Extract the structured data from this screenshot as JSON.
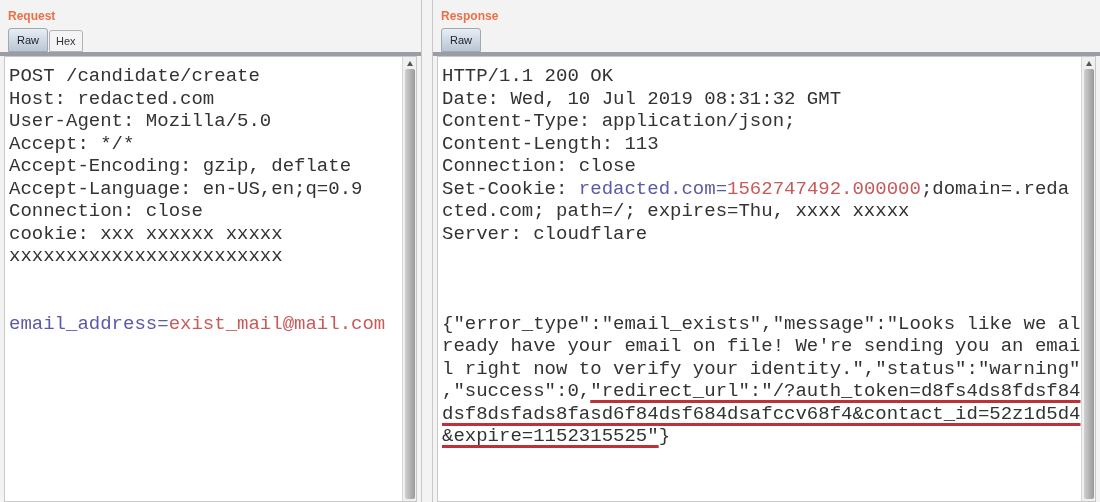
{
  "request": {
    "title": "Request",
    "tabs": [
      {
        "label": "Raw",
        "selected": true
      },
      {
        "label": "Hex",
        "selected": false
      }
    ],
    "lines": [
      {
        "kind": "text",
        "segments": [
          {
            "kind": "plain",
            "text": "POST /candidate/create"
          }
        ]
      },
      {
        "kind": "text",
        "segments": [
          {
            "kind": "plain",
            "text": "Host: redacted.com"
          }
        ]
      },
      {
        "kind": "text",
        "segments": [
          {
            "kind": "plain",
            "text": "User-Agent: Mozilla/5.0"
          }
        ]
      },
      {
        "kind": "text",
        "segments": [
          {
            "kind": "plain",
            "text": "Accept: */*"
          }
        ]
      },
      {
        "kind": "text",
        "segments": [
          {
            "kind": "plain",
            "text": "Accept-Encoding: gzip, deflate"
          }
        ]
      },
      {
        "kind": "text",
        "segments": [
          {
            "kind": "plain",
            "text": "Accept-Language: en-US,en;q=0.9"
          }
        ]
      },
      {
        "kind": "text",
        "segments": [
          {
            "kind": "plain",
            "text": "Connection: close"
          }
        ]
      },
      {
        "kind": "text",
        "segments": [
          {
            "kind": "plain",
            "text": "cookie: xxx xxxxxx xxxxx"
          }
        ]
      },
      {
        "kind": "text",
        "segments": [
          {
            "kind": "plain",
            "text": "xxxxxxxxxxxxxxxxxxxxxxxx"
          }
        ]
      },
      {
        "kind": "gap"
      },
      {
        "kind": "gap"
      },
      {
        "kind": "text",
        "segments": [
          {
            "kind": "name",
            "text": "email_address="
          },
          {
            "kind": "value",
            "text": "exist_mail@mail.com"
          }
        ]
      }
    ]
  },
  "response": {
    "title": "Response",
    "tabs": [
      {
        "label": "Raw",
        "selected": true
      }
    ],
    "lines": [
      {
        "kind": "text",
        "segments": [
          {
            "kind": "plain",
            "text": "HTTP/1.1 200 OK"
          }
        ]
      },
      {
        "kind": "text",
        "segments": [
          {
            "kind": "plain",
            "text": "Date: Wed, 10 Jul 2019 08:31:32 GMT"
          }
        ]
      },
      {
        "kind": "text",
        "segments": [
          {
            "kind": "plain",
            "text": "Content-Type: application/json;"
          }
        ]
      },
      {
        "kind": "text",
        "segments": [
          {
            "kind": "plain",
            "text": "Content-Length: 113"
          }
        ]
      },
      {
        "kind": "text",
        "segments": [
          {
            "kind": "plain",
            "text": "Connection: close"
          }
        ]
      },
      {
        "kind": "text",
        "segments": [
          {
            "kind": "plain",
            "text": "Set-Cookie: "
          },
          {
            "kind": "name",
            "text": "redacted.com="
          },
          {
            "kind": "value",
            "text": "1562747492.000000"
          },
          {
            "kind": "plain",
            "text": ";domain=.reda"
          }
        ]
      },
      {
        "kind": "text",
        "segments": [
          {
            "kind": "plain",
            "text": "cted.com; path=/; expires=Thu, xxxx xxxxx"
          }
        ]
      },
      {
        "kind": "text",
        "segments": [
          {
            "kind": "plain",
            "text": "Server: cloudflare"
          }
        ]
      },
      {
        "kind": "gap"
      },
      {
        "kind": "gap"
      },
      {
        "kind": "gap"
      },
      {
        "kind": "text",
        "segments": [
          {
            "kind": "plain",
            "text": "{\"error_type\":\"email_exists\",\"message\":\"Looks like we al"
          }
        ]
      },
      {
        "kind": "text",
        "segments": [
          {
            "kind": "plain",
            "text": "ready have your email on file! We're sending you an emai"
          }
        ]
      },
      {
        "kind": "text",
        "segments": [
          {
            "kind": "plain",
            "text": "l right now to verify your identity.\",\"status\":\"warning\""
          }
        ]
      },
      {
        "kind": "text",
        "segments": [
          {
            "kind": "plain",
            "text": ",\"success\":0,"
          },
          {
            "kind": "marked",
            "text": "\"redirect_url\":\"/?auth_token=d8fs4ds8fdsf84"
          }
        ]
      },
      {
        "kind": "text",
        "segments": [
          {
            "kind": "marked",
            "text": "dsf8dsfads8fasd6f84dsf684dsafccv68f4&contact_id=52z1d5d4"
          }
        ]
      },
      {
        "kind": "text",
        "segments": [
          {
            "kind": "marked",
            "text": "&expire=1152315525\""
          },
          {
            "kind": "plain",
            "text": "}"
          }
        ]
      }
    ]
  }
}
